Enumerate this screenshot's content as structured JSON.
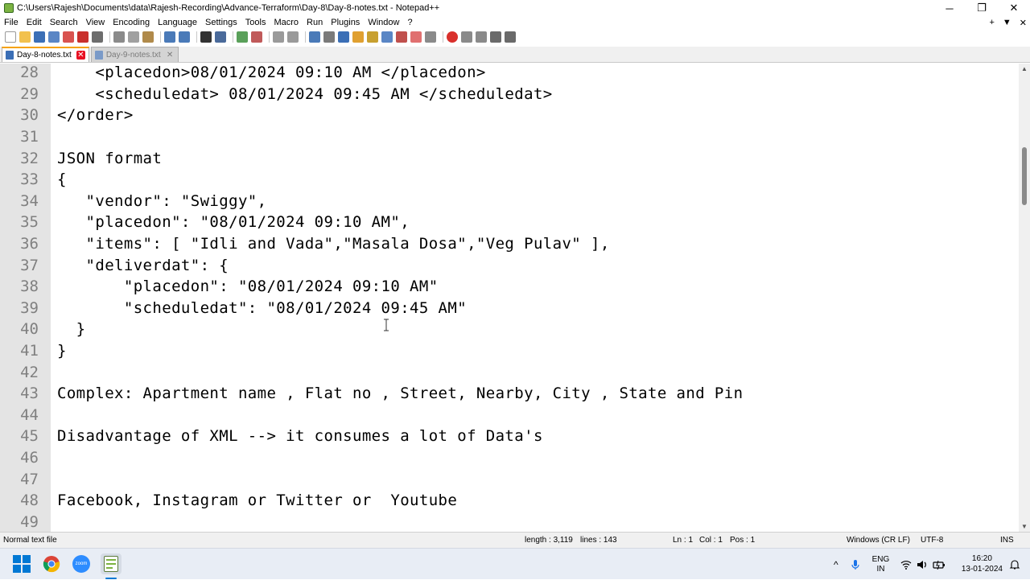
{
  "window": {
    "title": "C:\\Users\\Rajesh\\Documents\\data\\Rajesh-Recording\\Advance-Terraform\\Day-8\\Day-8-notes.txt - Notepad++",
    "minimize": "─",
    "restore": "❐",
    "close": "✕"
  },
  "menu": {
    "items": [
      "File",
      "Edit",
      "Search",
      "View",
      "Encoding",
      "Language",
      "Settings",
      "Tools",
      "Macro",
      "Run",
      "Plugins",
      "Window",
      "?"
    ],
    "right_plus": "+",
    "right_dropdown": "▼",
    "right_close": "✕"
  },
  "tabs": [
    {
      "label": "Day-8-notes.txt",
      "active": true,
      "close": "✕"
    },
    {
      "label": "Day-9-notes.txt",
      "active": false,
      "close": "✕"
    }
  ],
  "editor": {
    "lines": [
      {
        "num": "28",
        "text": "    <placedon>08/01/2024 09:10 AM </placedon>"
      },
      {
        "num": "29",
        "text": "    <scheduledat> 08/01/2024 09:45 AM </scheduledat>"
      },
      {
        "num": "30",
        "text": "</order>"
      },
      {
        "num": "31",
        "text": ""
      },
      {
        "num": "32",
        "text": "JSON format"
      },
      {
        "num": "33",
        "text": "{"
      },
      {
        "num": "34",
        "text": "   \"vendor\": \"Swiggy\","
      },
      {
        "num": "35",
        "text": "   \"placedon\": \"08/01/2024 09:10 AM\","
      },
      {
        "num": "36",
        "text": "   \"items\": [ \"Idli and Vada\",\"Masala Dosa\",\"Veg Pulav\" ],"
      },
      {
        "num": "37",
        "text": "   \"deliverdat\": {"
      },
      {
        "num": "38",
        "text": "       \"placedon\": \"08/01/2024 09:10 AM\""
      },
      {
        "num": "39",
        "text": "       \"scheduledat\": \"08/01/2024 09:45 AM\""
      },
      {
        "num": "40",
        "text": "  }"
      },
      {
        "num": "41",
        "text": "}"
      },
      {
        "num": "42",
        "text": ""
      },
      {
        "num": "43",
        "text": "Complex: Apartment name , Flat no , Street, Nearby, City , State and Pin"
      },
      {
        "num": "44",
        "text": ""
      },
      {
        "num": "45",
        "text": "Disadvantage of XML --> it consumes a lot of Data's"
      },
      {
        "num": "46",
        "text": ""
      },
      {
        "num": "47",
        "text": ""
      },
      {
        "num": "48",
        "text": "Facebook, Instagram or Twitter or  Youtube"
      },
      {
        "num": "49",
        "text": ""
      }
    ]
  },
  "status": {
    "file_type": "Normal text file",
    "length": "length : 3,119",
    "lines": "lines : 143",
    "ln": "Ln : 1",
    "col": "Col : 1",
    "pos": "Pos : 1",
    "eol": "Windows (CR LF)",
    "encoding": "UTF-8",
    "mode": "INS"
  },
  "taskbar": {
    "lang_top": "ENG",
    "lang_bottom": "IN",
    "time": "16:20",
    "date": "13-01-2024",
    "zoom_label": "zoom",
    "chevron": "^"
  },
  "colors": {
    "tab_accent": "#f7a200",
    "gutter": "#e4e4e4",
    "line_number": "#808080",
    "taskbar_bg": "#e8edf5",
    "windows_blue": "#0078d4"
  }
}
